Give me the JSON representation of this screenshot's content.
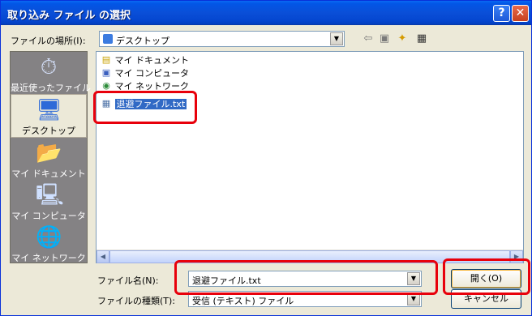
{
  "window": {
    "title": "取り込み ファイル の選択",
    "help_glyph": "?",
    "close_glyph": "✕"
  },
  "location": {
    "label": "ファイルの場所(I):",
    "value": "デスクトップ"
  },
  "toolbar": {
    "back_glyph": "⇦",
    "up_glyph": "▣",
    "newfolder_glyph": "✦",
    "views_glyph": "▦"
  },
  "sidebar": {
    "items": [
      {
        "label": "最近使ったファイル",
        "icon": "recent-icon",
        "glyph": "⏱"
      },
      {
        "label": "デスクトップ",
        "icon": "desktop-icon",
        "glyph": "🖥"
      },
      {
        "label": "マイ ドキュメント",
        "icon": "my-documents-icon",
        "glyph": "📂"
      },
      {
        "label": "マイ コンピュータ",
        "icon": "my-computer-icon",
        "glyph": "🖳"
      },
      {
        "label": "マイ ネットワーク",
        "icon": "my-network-icon",
        "glyph": "🌐"
      }
    ]
  },
  "files": [
    {
      "name": "マイ ドキュメント",
      "icon": "folder-icon",
      "glyph": "▤"
    },
    {
      "name": "マイ コンピュータ",
      "icon": "computer-icon",
      "glyph": "▣"
    },
    {
      "name": "マイ ネットワーク",
      "icon": "network-icon",
      "glyph": "◉"
    },
    {
      "name": "退避ファイル.txt",
      "icon": "text-file-icon",
      "glyph": "▦"
    }
  ],
  "filename": {
    "label": "ファイル名(N):",
    "value": "退避ファイル.txt"
  },
  "filetype": {
    "label": "ファイルの種類(T):",
    "value": "受信 (テキスト) ファイル"
  },
  "buttons": {
    "open": "開く(O)",
    "cancel": "キャンセル"
  },
  "scroll": {
    "left_glyph": "◀",
    "right_glyph": "▶",
    "down_glyph": "▼"
  },
  "colors": {
    "highlight": "#e8000b",
    "selection": "#316ac5",
    "titlebar": "#0a4fd8"
  }
}
